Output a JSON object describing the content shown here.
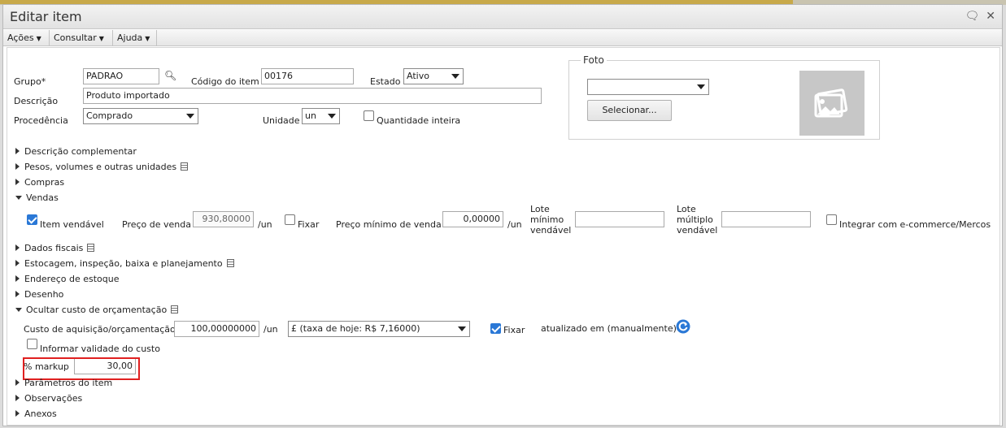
{
  "window": {
    "title": "Editar item"
  },
  "icons": {
    "chat": "chat-bubble-icon",
    "close": "close-icon",
    "search": "magnifier-icon",
    "refresh": "refresh-icon",
    "photo": "image-placeholder-icon"
  },
  "colors": {
    "accent": "#2a78d6",
    "highlight": "#e02020"
  },
  "menu": {
    "acoes": "Ações",
    "consultar": "Consultar",
    "ajuda": "Ajuda"
  },
  "form": {
    "grupo_label": "Grupo*",
    "grupo_value": "PADRAO",
    "codigo_label": "Código do item",
    "codigo_value": "00176",
    "estado_label": "Estado",
    "estado_value": "Ativo",
    "descricao_label": "Descrição",
    "descricao_value": "Produto importado",
    "procedencia_label": "Procedência",
    "procedencia_value": "Comprado",
    "unidade_label": "Unidade",
    "unidade_value": "un",
    "qtd_inteira_label": "Quantidade inteira"
  },
  "foto": {
    "legend": "Foto",
    "select_value": "",
    "button": "Selecionar..."
  },
  "sections": {
    "desc_complementar": "Descrição complementar",
    "pesos": "Pesos, volumes e outras unidades",
    "compras": "Compras",
    "vendas": "Vendas",
    "dados_fiscais": "Dados fiscais",
    "estocagem": "Estocagem, inspeção, baixa e planejamento",
    "endereco": "Endereço de estoque",
    "desenho": "Desenho",
    "ocultar_custo": "Ocultar custo de orçamentação",
    "parametros": "Parâmetros do item",
    "observacoes": "Observações",
    "anexos": "Anexos"
  },
  "vendas": {
    "item_vendavel": "Item vendável",
    "preco_venda_label": "Preço de venda",
    "preco_venda_value": "930,80000",
    "unit1": "/un",
    "fixar": "Fixar",
    "preco_min_label": "Preço mínimo de venda",
    "preco_min_value": "0,00000",
    "unit2": "/un",
    "lote_minimo_l1": "Lote",
    "lote_minimo_l2": "mínimo",
    "lote_minimo_l3": "vendável",
    "lote_minimo_value": "",
    "lote_multiplo_l1": "Lote",
    "lote_multiplo_l2": "múltiplo",
    "lote_multiplo_l3": "vendável",
    "lote_multiplo_value": "",
    "integrar": "Integrar com e-commerce/Mercos"
  },
  "custo": {
    "label": "Custo de aquisição/orçamentação",
    "value": "100,00000000",
    "unit": "/un",
    "moeda": "£ (taxa de hoje: R$ 7,16000)",
    "fixar": "Fixar",
    "atualizado": "atualizado em (manualmente)",
    "validade": "Informar validade do custo",
    "markup_label": "% markup",
    "markup_value": "30,00"
  }
}
